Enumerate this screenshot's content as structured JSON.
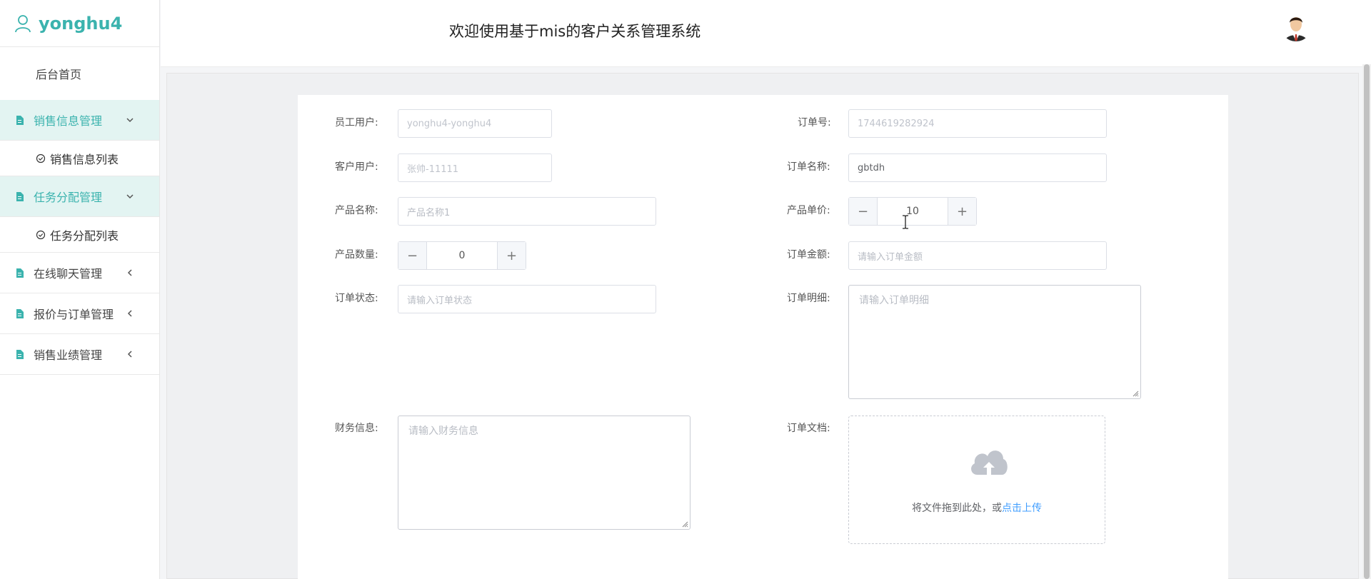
{
  "sidebar": {
    "username": "yonghu4",
    "home": "后台首页",
    "menus": [
      {
        "label": "销售信息管理",
        "sub": "销售信息列表"
      },
      {
        "label": "任务分配管理",
        "sub": "任务分配列表"
      },
      {
        "label": "在线聊天管理"
      },
      {
        "label": "报价与订单管理"
      },
      {
        "label": "销售业绩管理"
      }
    ],
    "accent_color": "#3bb3ae"
  },
  "header": {
    "title": "欢迎使用基于mis的客户关系管理系统"
  },
  "form": {
    "staff_user": {
      "label": "员工用户:",
      "value": "yonghu4-yonghu4"
    },
    "order_no": {
      "label": "订单号:",
      "value": "1744619282924"
    },
    "customer_user": {
      "label": "客户用户:",
      "value": "张帅-11111"
    },
    "order_name": {
      "label": "订单名称:",
      "value": "gbtdh"
    },
    "product_name": {
      "label": "产品名称:",
      "placeholder": "产品名称1"
    },
    "unit_price": {
      "label": "产品单价:",
      "value": "10",
      "minus": "−",
      "plus": "+"
    },
    "quantity": {
      "label": "产品数量:",
      "value": "0",
      "minus": "−",
      "plus": "+"
    },
    "order_amount": {
      "label": "订单金额:",
      "placeholder": "请输入订单金额"
    },
    "order_status": {
      "label": "订单状态:",
      "placeholder": "请输入订单状态"
    },
    "order_detail": {
      "label": "订单明细:",
      "placeholder": "请输入订单明细"
    },
    "finance": {
      "label": "财务信息:",
      "placeholder": "请输入财务信息"
    },
    "order_doc": {
      "label": "订单文档:",
      "upload_text": "将文件拖到此处，或",
      "upload_link": "点击上传"
    }
  }
}
